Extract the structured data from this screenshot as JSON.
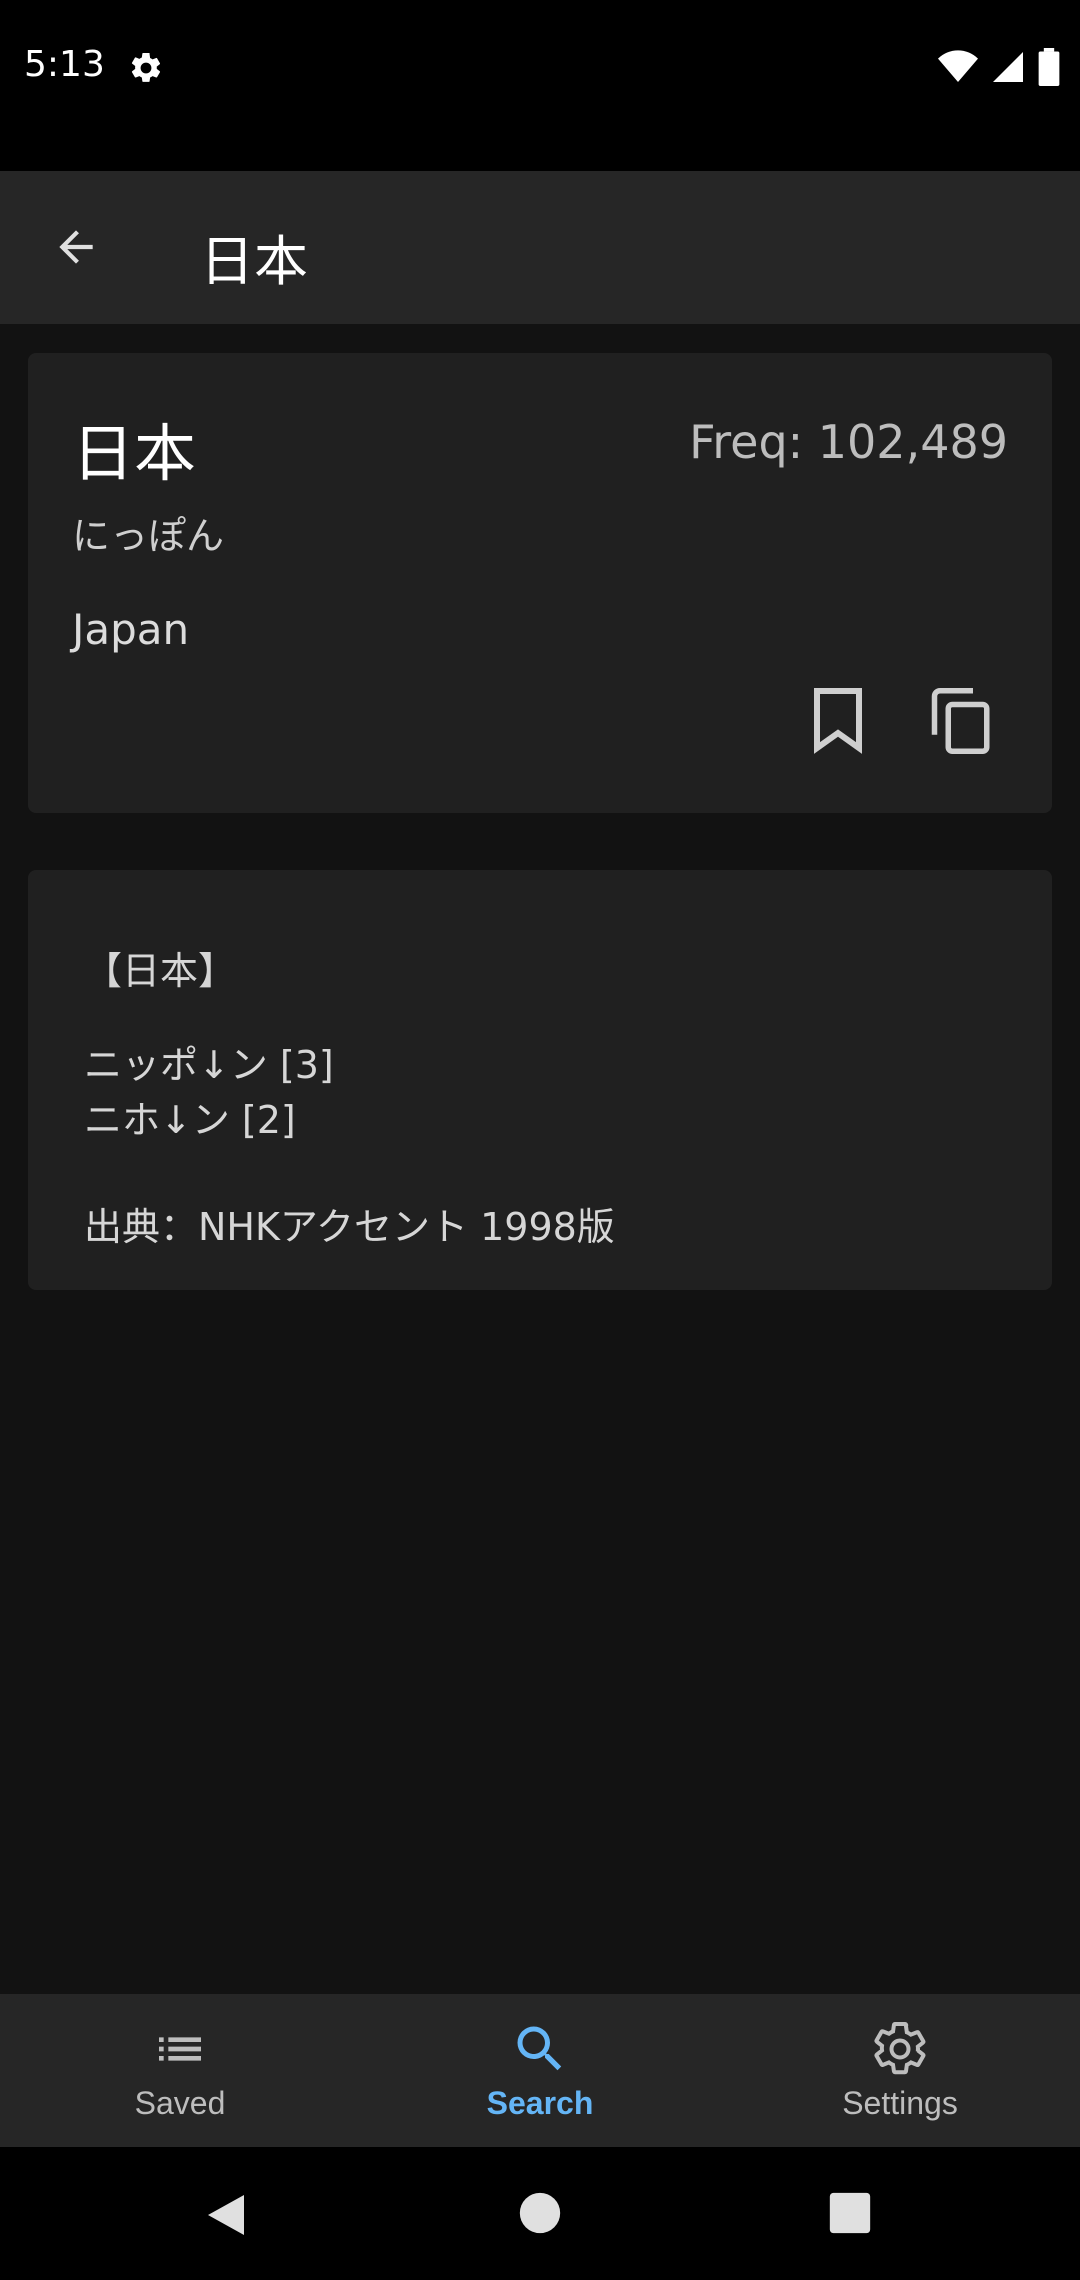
{
  "status_bar": {
    "time": "5:13",
    "icons": [
      "gear-icon",
      "wifi-icon",
      "signal-icon",
      "battery-icon"
    ]
  },
  "app_bar": {
    "title": "日本",
    "back_icon": "arrow-left-icon"
  },
  "entry": {
    "word": "日本",
    "frequency": "Freq: 102,489",
    "reading": "にっぽん",
    "meaning": "Japan",
    "actions": [
      "bookmark-icon",
      "copy-icon"
    ]
  },
  "pitch_card": {
    "heading": "【日本】",
    "lines": [
      "ニッポ↓ン [3]",
      "ニホ↓ン [2]"
    ],
    "source": "出典：NHKアクセント 1998版"
  },
  "bottom_nav": {
    "items": [
      {
        "label": "Saved",
        "icon": "list-icon",
        "active": false
      },
      {
        "label": "Search",
        "icon": "search-icon",
        "active": true
      },
      {
        "label": "Settings",
        "icon": "gear-icon",
        "active": false
      }
    ],
    "active_color": "#64b5f6"
  },
  "system_nav": [
    "back-triangle-icon",
    "home-circle-icon",
    "recents-square-icon"
  ]
}
